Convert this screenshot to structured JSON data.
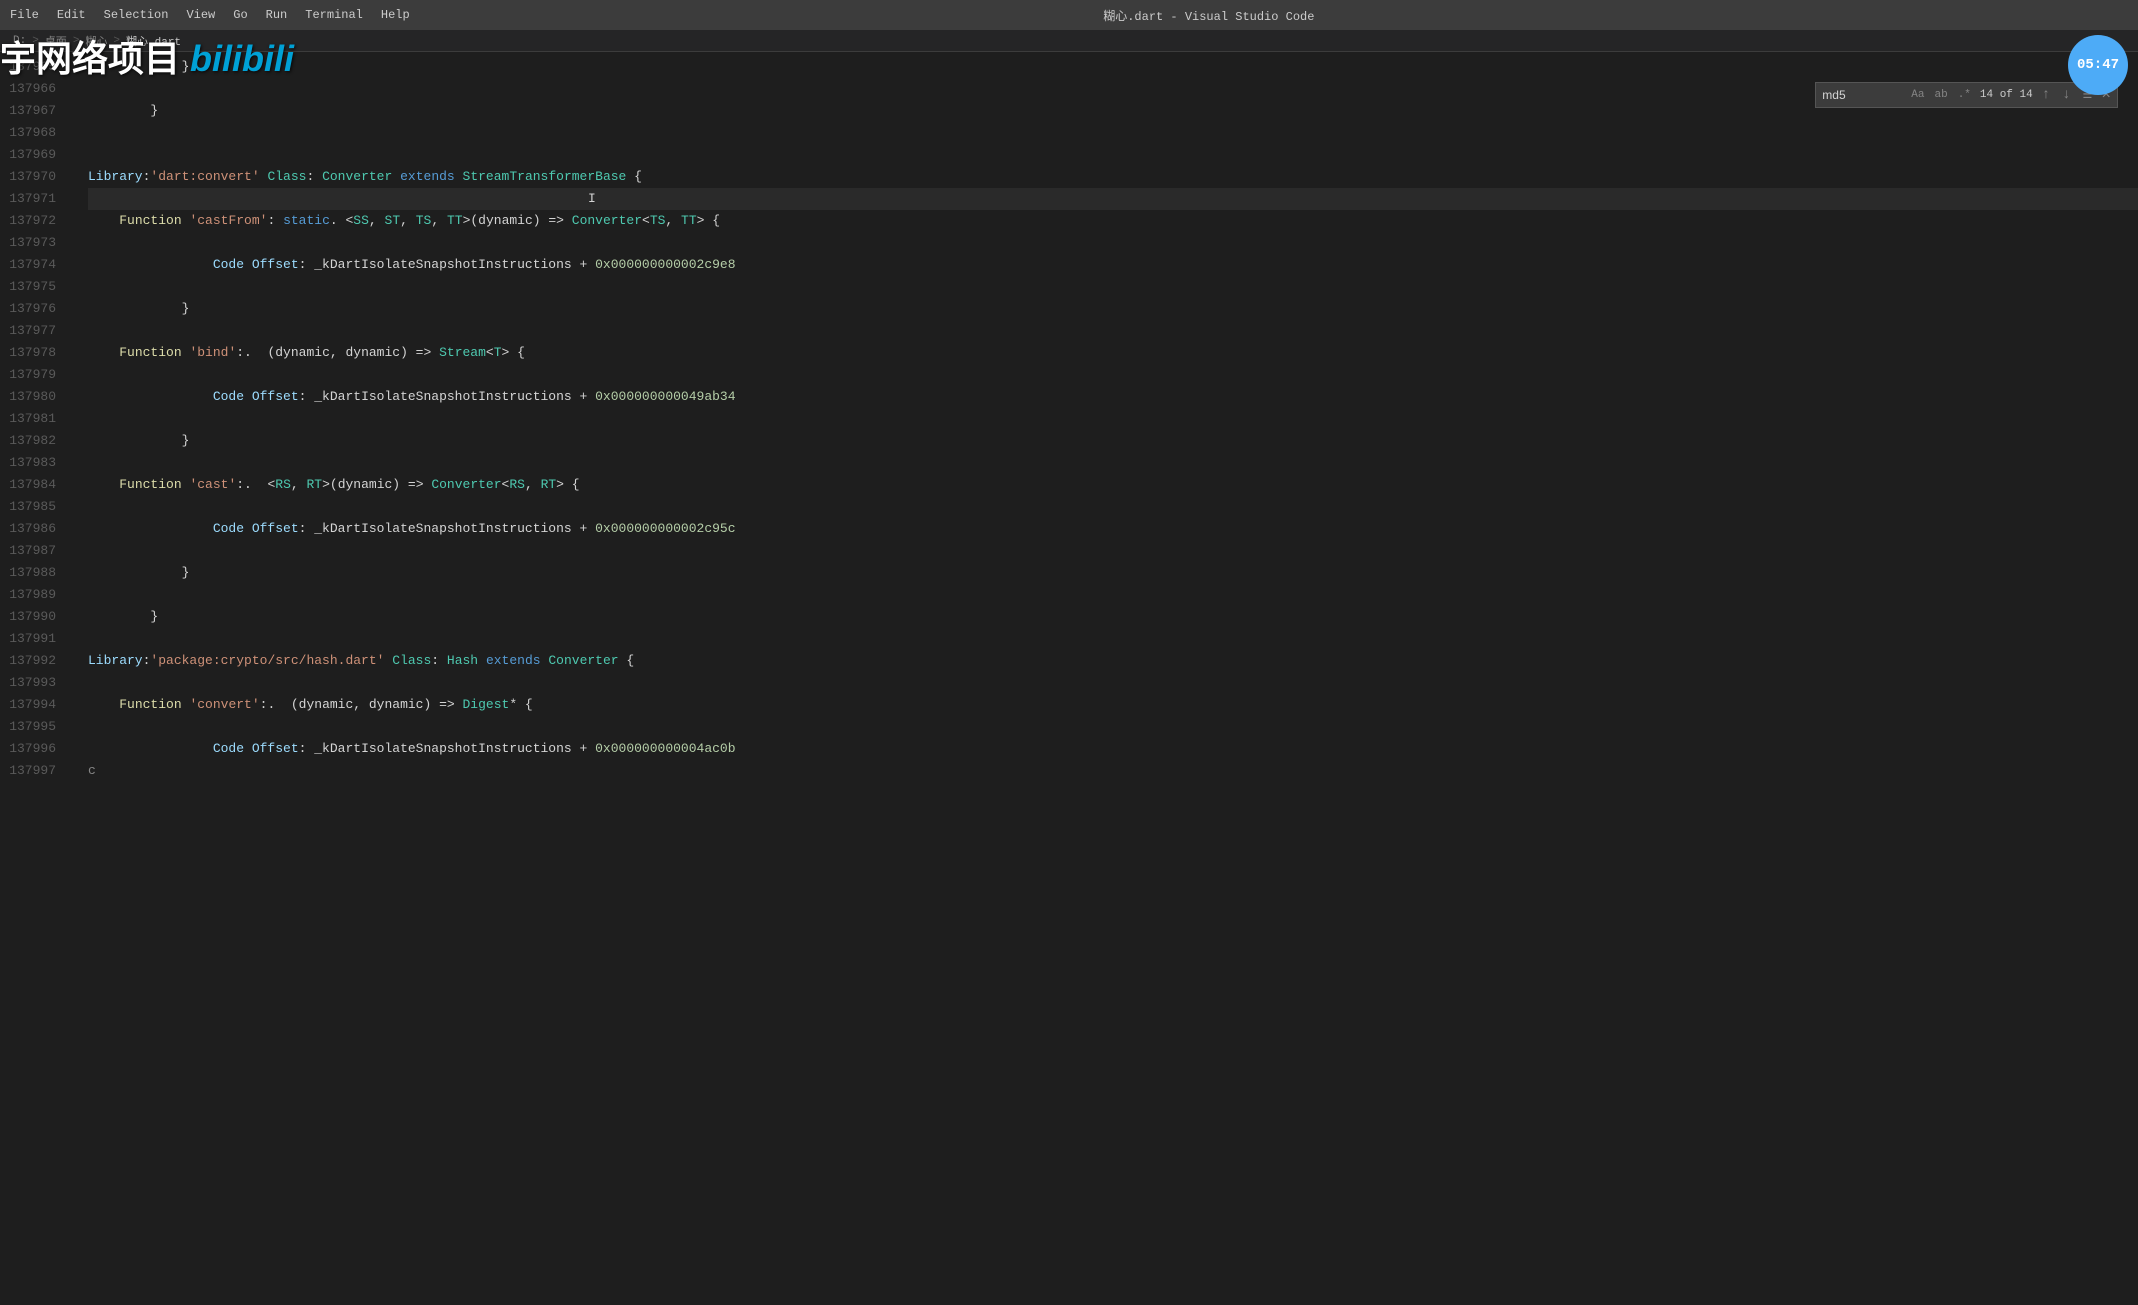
{
  "titlebar": {
    "menu_items": [
      "File",
      "Edit",
      "Selection",
      "View",
      "Go",
      "Run",
      "Terminal",
      "Help"
    ],
    "title": "糊心.dart - Visual Studio Code"
  },
  "watermark": {
    "text": "宇网络项目",
    "bilibili": "bilibili"
  },
  "timer": "05:47",
  "breadcrumb": {
    "parts": [
      "D:",
      "桌面",
      "糊心",
      "糊心.dart"
    ]
  },
  "search": {
    "query": "md5",
    "placeholder": "",
    "count": "14 of 14",
    "match_case": "Aa",
    "whole_word": "ab",
    "regex": ".*"
  },
  "lines": [
    {
      "num": "137965",
      "code": [
        {
          "t": "punct",
          "v": "            }"
        }
      ]
    },
    {
      "num": "137966",
      "code": []
    },
    {
      "num": "137967",
      "code": [
        {
          "t": "punct",
          "v": "        }"
        }
      ]
    },
    {
      "num": "137968",
      "code": []
    },
    {
      "num": "137969",
      "code": []
    },
    {
      "num": "137970",
      "code": [
        {
          "t": "kw-library",
          "v": "Library"
        },
        {
          "t": "punct",
          "v": ":"
        },
        {
          "t": "str",
          "v": "'dart:convert'"
        },
        {
          "t": "punct",
          "v": " "
        },
        {
          "t": "kw-class",
          "v": "Class"
        },
        {
          "t": "punct",
          "v": ": "
        },
        {
          "t": "cls-name",
          "v": "Converter"
        },
        {
          "t": "punct",
          "v": " "
        },
        {
          "t": "kw-extends",
          "v": "extends"
        },
        {
          "t": "punct",
          "v": " "
        },
        {
          "t": "cls-name",
          "v": "StreamTransformerBase"
        },
        {
          "t": "punct",
          "v": " {"
        }
      ]
    },
    {
      "num": "137971",
      "code": [
        {
          "t": "cursor",
          "v": "    I"
        }
      ]
    },
    {
      "num": "137972",
      "code": [
        {
          "t": "punct",
          "v": "    "
        },
        {
          "t": "kw-function",
          "v": "Function"
        },
        {
          "t": "str",
          "v": " 'castFrom'"
        },
        {
          "t": "punct",
          "v": ": "
        },
        {
          "t": "kw-static",
          "v": "static"
        },
        {
          "t": "punct",
          "v": ". <"
        },
        {
          "t": "type-param",
          "v": "SS"
        },
        {
          "t": "punct",
          "v": ", "
        },
        {
          "t": "type-param",
          "v": "ST"
        },
        {
          "t": "punct",
          "v": ", "
        },
        {
          "t": "type-param",
          "v": "TS"
        },
        {
          "t": "punct",
          "v": ", "
        },
        {
          "t": "type-param",
          "v": "TT"
        },
        {
          "t": "punct",
          "v": ">(dynamic) => "
        },
        {
          "t": "cls-name",
          "v": "Converter"
        },
        {
          "t": "punct",
          "v": "<"
        },
        {
          "t": "type-param",
          "v": "TS"
        },
        {
          "t": "punct",
          "v": ", "
        },
        {
          "t": "type-param",
          "v": "TT"
        },
        {
          "t": "punct",
          "v": "\\> {"
        }
      ]
    },
    {
      "num": "137973",
      "code": []
    },
    {
      "num": "137974",
      "code": [
        {
          "t": "punct",
          "v": "                "
        },
        {
          "t": "kw-code",
          "v": "Code Offset"
        },
        {
          "t": "punct",
          "v": ": _kDartIsolateSnapshotInstructions + "
        },
        {
          "t": "offset-val",
          "v": "0x000000000002c9e8"
        }
      ]
    },
    {
      "num": "137975",
      "code": []
    },
    {
      "num": "137976",
      "code": [
        {
          "t": "punct",
          "v": "            }"
        }
      ]
    },
    {
      "num": "137977",
      "code": []
    },
    {
      "num": "137978",
      "code": [
        {
          "t": "punct",
          "v": "    "
        },
        {
          "t": "kw-function",
          "v": "Function"
        },
        {
          "t": "str",
          "v": " 'bind'"
        },
        {
          "t": "punct",
          "v": ":.  (dynamic, dynamic) => "
        },
        {
          "t": "cls-name",
          "v": "Stream"
        },
        {
          "t": "punct",
          "v": "<"
        },
        {
          "t": "type-param",
          "v": "T"
        },
        {
          "t": "punct",
          "v": "\\> {"
        }
      ]
    },
    {
      "num": "137979",
      "code": []
    },
    {
      "num": "137980",
      "code": [
        {
          "t": "punct",
          "v": "                "
        },
        {
          "t": "kw-code",
          "v": "Code Offset"
        },
        {
          "t": "punct",
          "v": ": _kDartIsolateSnapshotInstructions + "
        },
        {
          "t": "offset-val",
          "v": "0x000000000049ab34"
        }
      ]
    },
    {
      "num": "137981",
      "code": []
    },
    {
      "num": "137982",
      "code": [
        {
          "t": "punct",
          "v": "            }"
        }
      ]
    },
    {
      "num": "137983",
      "code": []
    },
    {
      "num": "137984",
      "code": [
        {
          "t": "punct",
          "v": "    "
        },
        {
          "t": "kw-function",
          "v": "Function"
        },
        {
          "t": "str",
          "v": " 'cast'"
        },
        {
          "t": "punct",
          "v": ":.  <"
        },
        {
          "t": "type-param",
          "v": "RS"
        },
        {
          "t": "punct",
          "v": ", "
        },
        {
          "t": "type-param",
          "v": "RT"
        },
        {
          "t": "punct",
          "v": "\\>(dynamic) => "
        },
        {
          "t": "cls-name",
          "v": "Converter"
        },
        {
          "t": "punct",
          "v": "<"
        },
        {
          "t": "type-param",
          "v": "RS"
        },
        {
          "t": "punct",
          "v": ", "
        },
        {
          "t": "type-param",
          "v": "RT"
        },
        {
          "t": "punct",
          "v": "\\> {"
        }
      ]
    },
    {
      "num": "137985",
      "code": []
    },
    {
      "num": "137986",
      "code": [
        {
          "t": "punct",
          "v": "                "
        },
        {
          "t": "kw-code",
          "v": "Code Offset"
        },
        {
          "t": "punct",
          "v": ": _kDartIsolateSnapshotInstructions + "
        },
        {
          "t": "offset-val",
          "v": "0x000000000002c95c"
        }
      ]
    },
    {
      "num": "137987",
      "code": []
    },
    {
      "num": "137988",
      "code": [
        {
          "t": "punct",
          "v": "            }"
        }
      ]
    },
    {
      "num": "137989",
      "code": []
    },
    {
      "num": "137990",
      "code": [
        {
          "t": "punct",
          "v": "        }"
        }
      ]
    },
    {
      "num": "137991",
      "code": []
    },
    {
      "num": "137992",
      "code": [
        {
          "t": "kw-library",
          "v": "Library"
        },
        {
          "t": "punct",
          "v": ":"
        },
        {
          "t": "str",
          "v": "'package:crypto/src/hash.dart'"
        },
        {
          "t": "punct",
          "v": " "
        },
        {
          "t": "kw-class",
          "v": "Class"
        },
        {
          "t": "punct",
          "v": ": "
        },
        {
          "t": "cls-name",
          "v": "Hash"
        },
        {
          "t": "punct",
          "v": " "
        },
        {
          "t": "kw-extends",
          "v": "extends"
        },
        {
          "t": "punct",
          "v": " "
        },
        {
          "t": "cls-name",
          "v": "Converter"
        },
        {
          "t": "punct",
          "v": " {"
        }
      ]
    },
    {
      "num": "137993",
      "code": []
    },
    {
      "num": "137994",
      "code": [
        {
          "t": "punct",
          "v": "    "
        },
        {
          "t": "kw-function",
          "v": "Function"
        },
        {
          "t": "str",
          "v": " 'convert'"
        },
        {
          "t": "punct",
          "v": ":.  (dynamic, dynamic) => "
        },
        {
          "t": "cls-name",
          "v": "Digest"
        },
        {
          "t": "punct",
          "v": "* {"
        }
      ]
    },
    {
      "num": "137995",
      "code": []
    },
    {
      "num": "137996",
      "code": [
        {
          "t": "punct",
          "v": "                "
        },
        {
          "t": "kw-code",
          "v": "Code Offset"
        },
        {
          "t": "punct",
          "v": ": _kDartIsolateSnapshotInstructions + "
        },
        {
          "t": "offset-val",
          "v": "0x000000000004ac0b"
        }
      ]
    },
    {
      "num": "137997",
      "code": [
        {
          "t": "dim",
          "v": "c"
        }
      ]
    }
  ]
}
